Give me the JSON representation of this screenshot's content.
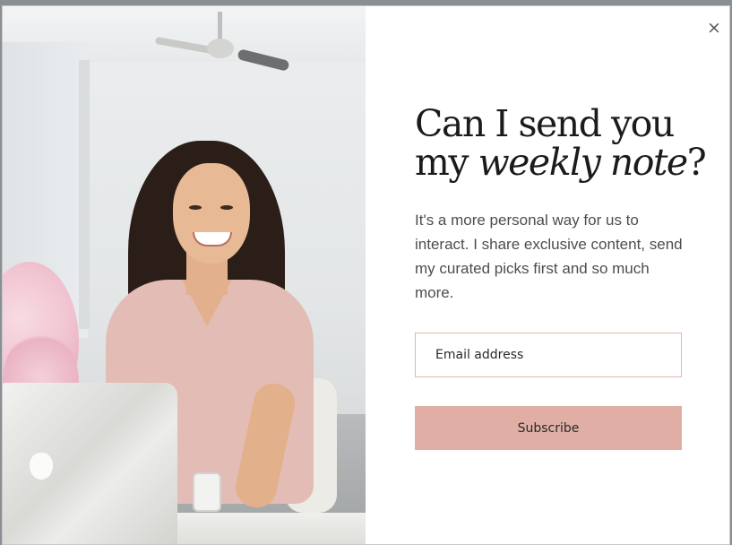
{
  "modal": {
    "close_label": "×",
    "headline": {
      "line1": "Can I send you",
      "line2_normal": "my ",
      "line2_italic": "weekly note",
      "line2_end": "?"
    },
    "body": "It's a more personal way for us to interact. I share exclusive content, send my curated picks first and so much more.",
    "email_placeholder": "Email address",
    "email_value": "",
    "subscribe_label": "Subscribe"
  },
  "photo": {
    "subject": "smiling-woman-at-laptop"
  },
  "colors": {
    "accent": "#e0aea5",
    "input_border": "#e3b6ad",
    "headline": "#1b1b1b",
    "body_text": "#4d4d4d"
  }
}
